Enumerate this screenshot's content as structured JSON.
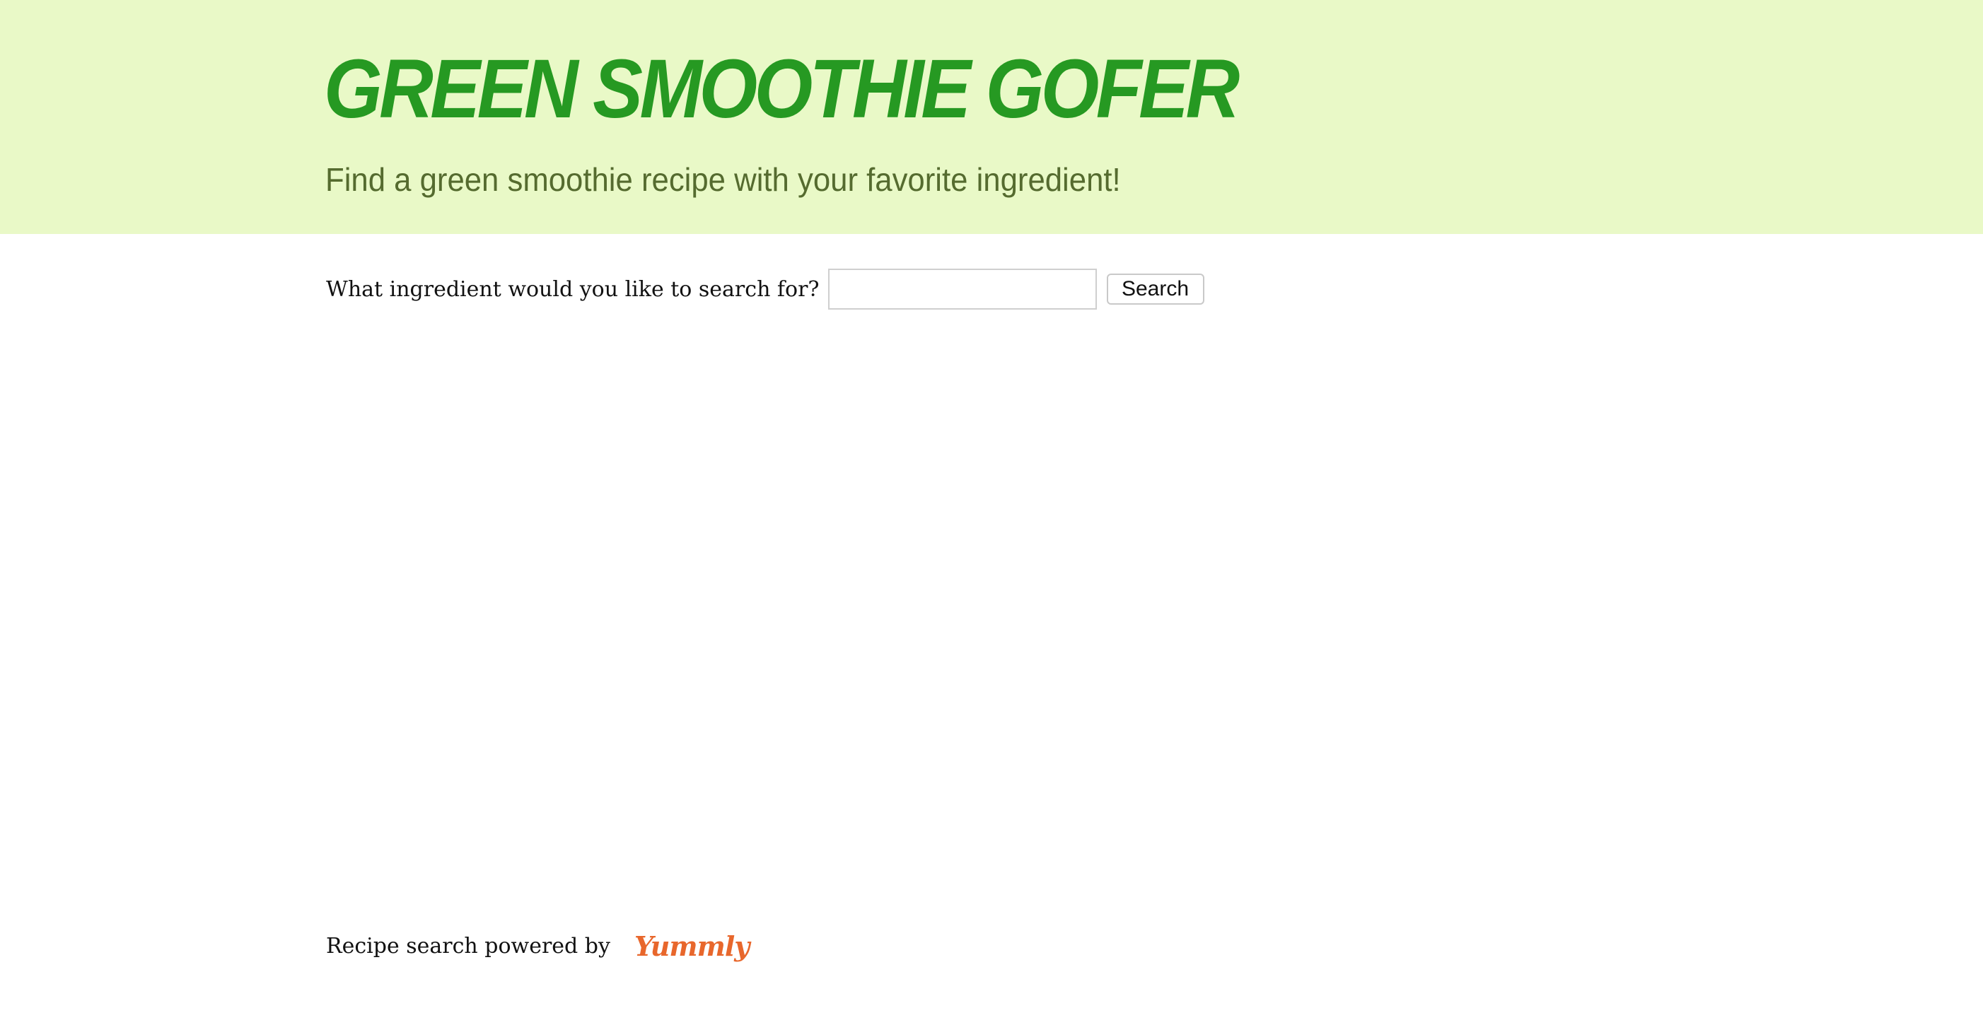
{
  "header": {
    "title": "GREEN SMOOTHIE GOFER",
    "tagline": "Find a green smoothie recipe with your favorite ingredient!"
  },
  "search": {
    "label": "What ingredient would you like to search for?",
    "value": "",
    "button_label": "Search"
  },
  "footer": {
    "text": "Recipe search powered by",
    "logo_text": "Yummly"
  },
  "colors": {
    "header_background": "#e9f9c7",
    "title": "#269922",
    "tagline": "#556b2f",
    "yummly_brand": "#e8672c"
  }
}
